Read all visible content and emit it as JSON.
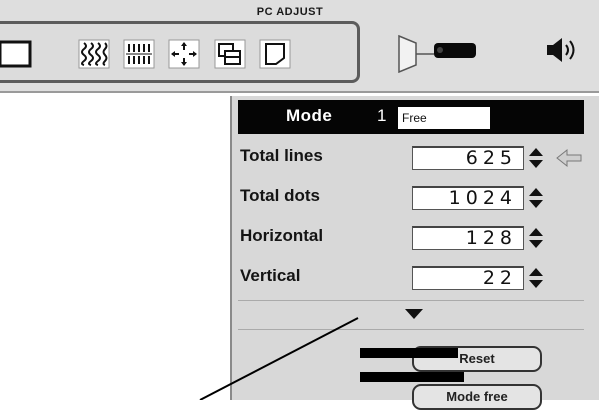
{
  "menu": {
    "title": "PC ADJUST",
    "toolbar_icons": [
      "input-select-icon",
      "fine-sync-icon",
      "total-dots-icon",
      "position-icon",
      "pc-adjust-icon",
      "screen-icon"
    ],
    "right_icons": [
      "projector-icon",
      "speaker-icon"
    ]
  },
  "dialog": {
    "mode_label": "Mode",
    "mode_number": "1",
    "mode_name": "Free",
    "rows": [
      {
        "label": "Total lines",
        "value": "625"
      },
      {
        "label": "Total dots",
        "value": "1024"
      },
      {
        "label": "Horizontal",
        "value": "128"
      },
      {
        "label": "Vertical",
        "value": "22"
      }
    ],
    "buttons": {
      "reset": "Reset",
      "mode_free": "Mode free"
    }
  },
  "colors": {
    "menu_bg": "#dedede",
    "panel_bg": "#d8d8d8",
    "header_bg": "#050505"
  }
}
